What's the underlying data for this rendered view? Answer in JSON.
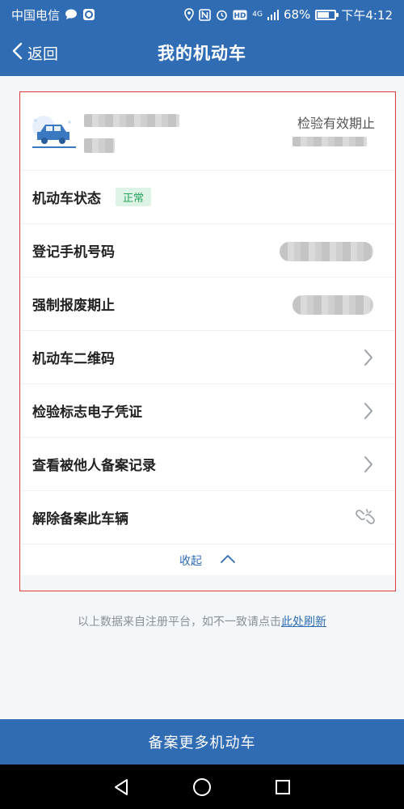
{
  "status_bar": {
    "carrier": "中国电信",
    "network": "4G",
    "battery_percent": "68%",
    "battery_level": 0.68,
    "time": "下午4:12"
  },
  "nav": {
    "back_label": "返回",
    "title": "我的机动车"
  },
  "vehicle": {
    "expiry_label": "检验有效期止"
  },
  "rows": [
    {
      "label": "机动车状态",
      "badge": "正常"
    },
    {
      "label": "登记手机号码"
    },
    {
      "label": "强制报废期止"
    },
    {
      "label": "机动车二维码"
    },
    {
      "label": "检验标志电子凭证"
    },
    {
      "label": "查看被他人备案记录"
    },
    {
      "label": "解除备案此车辆"
    }
  ],
  "collapse_label": "收起",
  "footnote": {
    "text": "以上数据来自注册平台，如不一致请点击",
    "link": "此处刷新"
  },
  "bottom_button": "备案更多机动车",
  "colors": {
    "primary": "#2f6cb3",
    "status_ok": "#27a35c",
    "highlight_border": "#e23b3b"
  }
}
